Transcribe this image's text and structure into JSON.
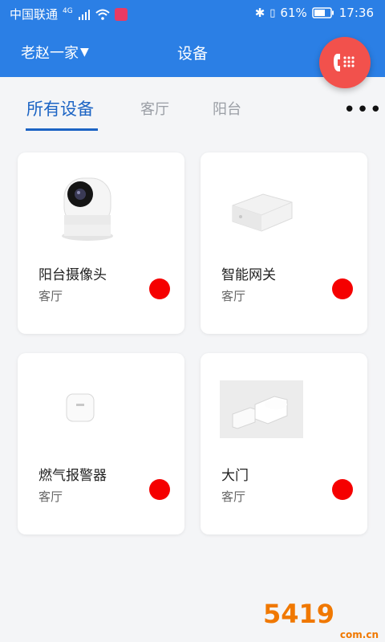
{
  "status_bar": {
    "carrier": "中国联通",
    "network": "4G",
    "battery": "61%",
    "time": "17:36"
  },
  "header": {
    "family": "老赵一家",
    "title": "设备"
  },
  "tabs": [
    {
      "label": "所有设备",
      "active": true
    },
    {
      "label": "客厅",
      "active": false
    },
    {
      "label": "阳台",
      "active": false
    }
  ],
  "more_label": "•••",
  "devices": [
    {
      "name": "阳台摄像头",
      "room": "客厅",
      "status_color": "#f50000",
      "icon": "camera-image"
    },
    {
      "name": "智能网关",
      "room": "客厅",
      "status_color": "#f50000",
      "icon": "gateway-image"
    },
    {
      "name": "燃气报警器",
      "room": "客厅",
      "status_color": "#f50000",
      "icon": "gas-alarm-image"
    },
    {
      "name": "大门",
      "room": "客厅",
      "status_color": "#f50000",
      "icon": "door-sensor-image"
    }
  ],
  "watermark": {
    "main": "5419",
    "sub": "com.cn"
  },
  "colors": {
    "primary": "#2b7fe5",
    "accent": "#1c64c4",
    "call": "#f2514c"
  }
}
